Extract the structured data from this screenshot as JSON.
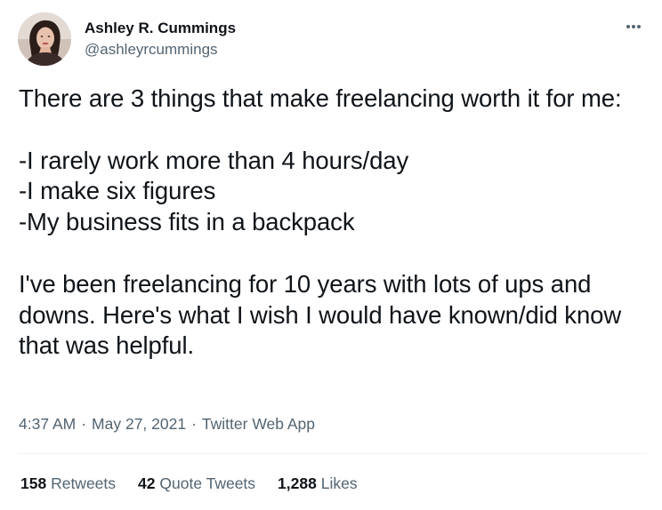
{
  "author": {
    "display_name": "Ashley R. Cummings",
    "handle": "@ashleyrcummings"
  },
  "tweet": {
    "text": "There are 3 things that make freelancing worth it for me:\n\n-I rarely work more than 4 hours/day\n-I make six figures\n-My business fits in a backpack\n\nI've been freelancing for 10 years with lots of ups and downs. Here's what I wish I would have known/did know that was helpful.",
    "time": "4:37 AM",
    "date": "May 27, 2021",
    "source": "Twitter Web App",
    "separator": "·"
  },
  "stats": [
    {
      "count": "158",
      "label": "Retweets"
    },
    {
      "count": "42",
      "label": "Quote Tweets"
    },
    {
      "count": "1,288",
      "label": "Likes"
    }
  ],
  "icons": {
    "more": "more-horizontal-icon",
    "avatar": "profile-photo"
  },
  "colors": {
    "primary_text": "#0f1419",
    "secondary_text": "#536471",
    "divider": "#eff3f4"
  }
}
